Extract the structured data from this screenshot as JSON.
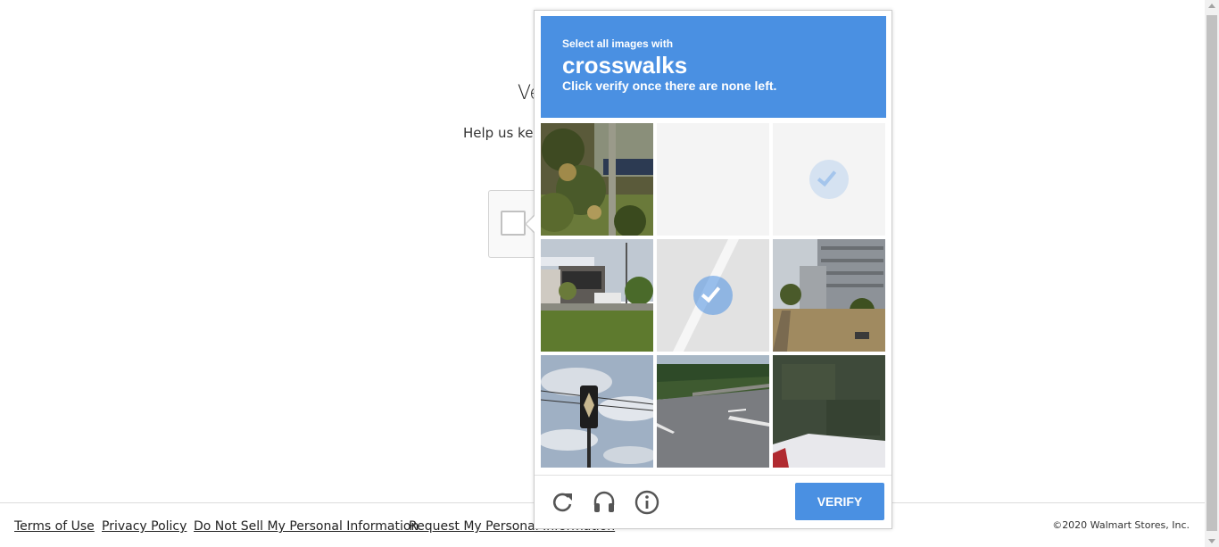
{
  "page": {
    "title_fragment": "Ve",
    "subtitle_fragment": "Help us kee"
  },
  "footer": {
    "links": [
      "Terms of Use",
      "Privacy Policy",
      "Do Not Sell My Personal Information",
      "Request My Personal Information"
    ],
    "copyright": "©2020 Walmart Stores, Inc."
  },
  "captcha": {
    "prompt_line1": "Select all images with",
    "keyword": "crosswalks",
    "prompt_line2": "Click verify once there are none left.",
    "verify_label": "VERIFY",
    "accent_color": "#4a90e2",
    "tools": [
      "refresh-icon",
      "audio-challenge-icon",
      "info-icon"
    ],
    "tiles": [
      {
        "scene": "tree-and-pole",
        "state": "unselected"
      },
      {
        "scene": "blank-loading",
        "state": "fading"
      },
      {
        "scene": "blank-loading",
        "state": "selected-fading"
      },
      {
        "scene": "storefront-parking",
        "state": "unselected"
      },
      {
        "scene": "road-marking",
        "state": "selected"
      },
      {
        "scene": "apartment-building",
        "state": "unselected"
      },
      {
        "scene": "traffic-signal-sky",
        "state": "unselected"
      },
      {
        "scene": "highway-lanes",
        "state": "unselected"
      },
      {
        "scene": "grass-car-hood",
        "state": "unselected"
      }
    ]
  }
}
